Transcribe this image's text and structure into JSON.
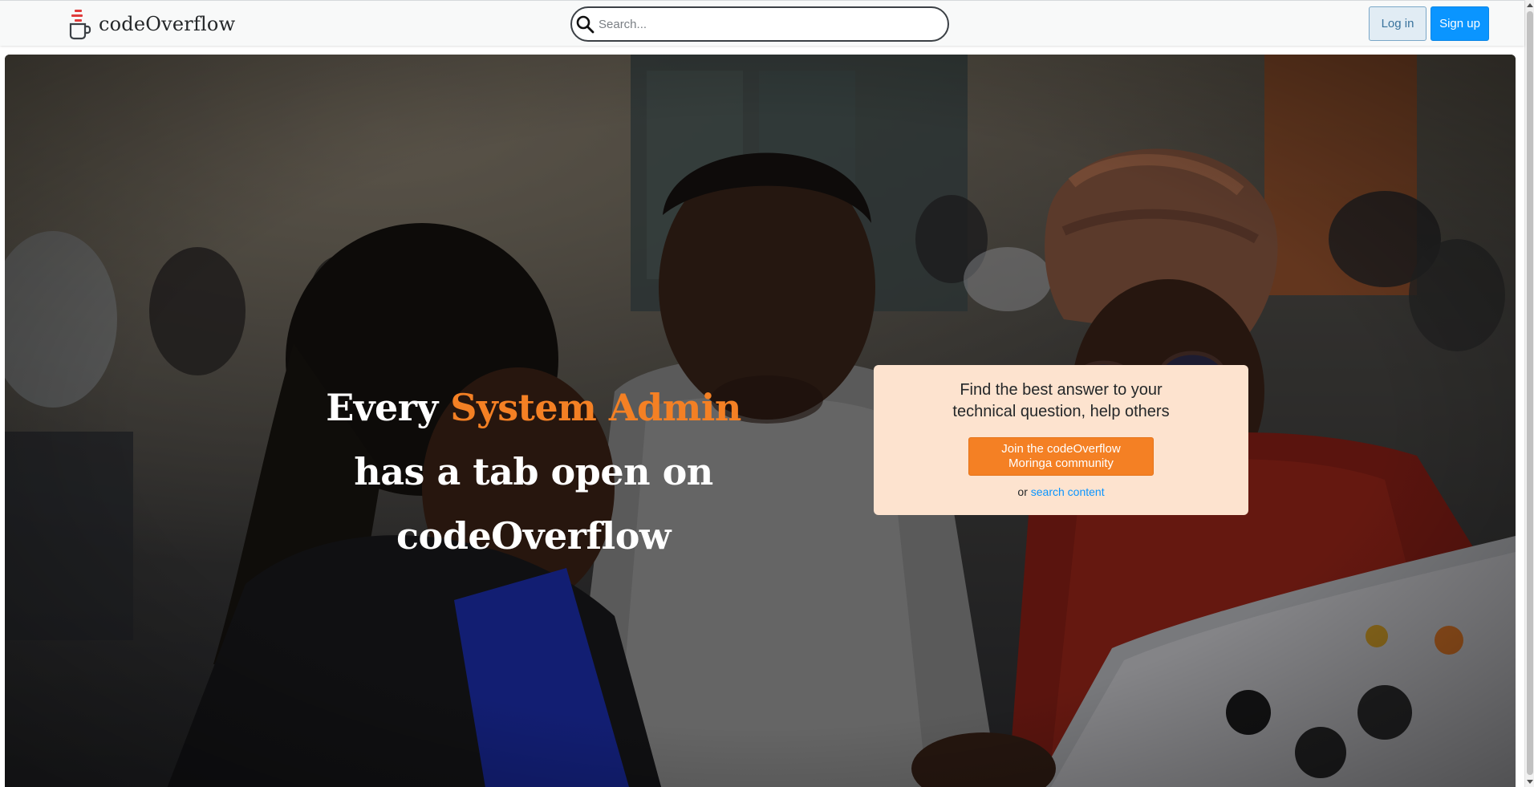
{
  "app": {
    "brand_name": "codeOverflow",
    "logo_icon": "coffee-mug-stack-logo"
  },
  "header": {
    "search": {
      "placeholder": "Search...",
      "value": "",
      "icon": "search-icon"
    },
    "login_label": "Log in",
    "signup_label": "Sign up"
  },
  "hero": {
    "headline": {
      "line1_prefix": "Every ",
      "line1_accent": "System Admin",
      "line2": "has a tab open on",
      "line3": "codeOverflow"
    },
    "card": {
      "text": "Find the best answer to your technical question, help others",
      "join_button_label": "Join the codeOverflow Moringa community",
      "or_text": "or ",
      "search_link_label": "search content"
    }
  },
  "colors": {
    "accent_orange": "#f48024",
    "card_bg": "#fde3cf",
    "signup_blue": "#0a95ff",
    "login_bg": "#e1ecf4",
    "link_blue": "#0a95ff"
  }
}
